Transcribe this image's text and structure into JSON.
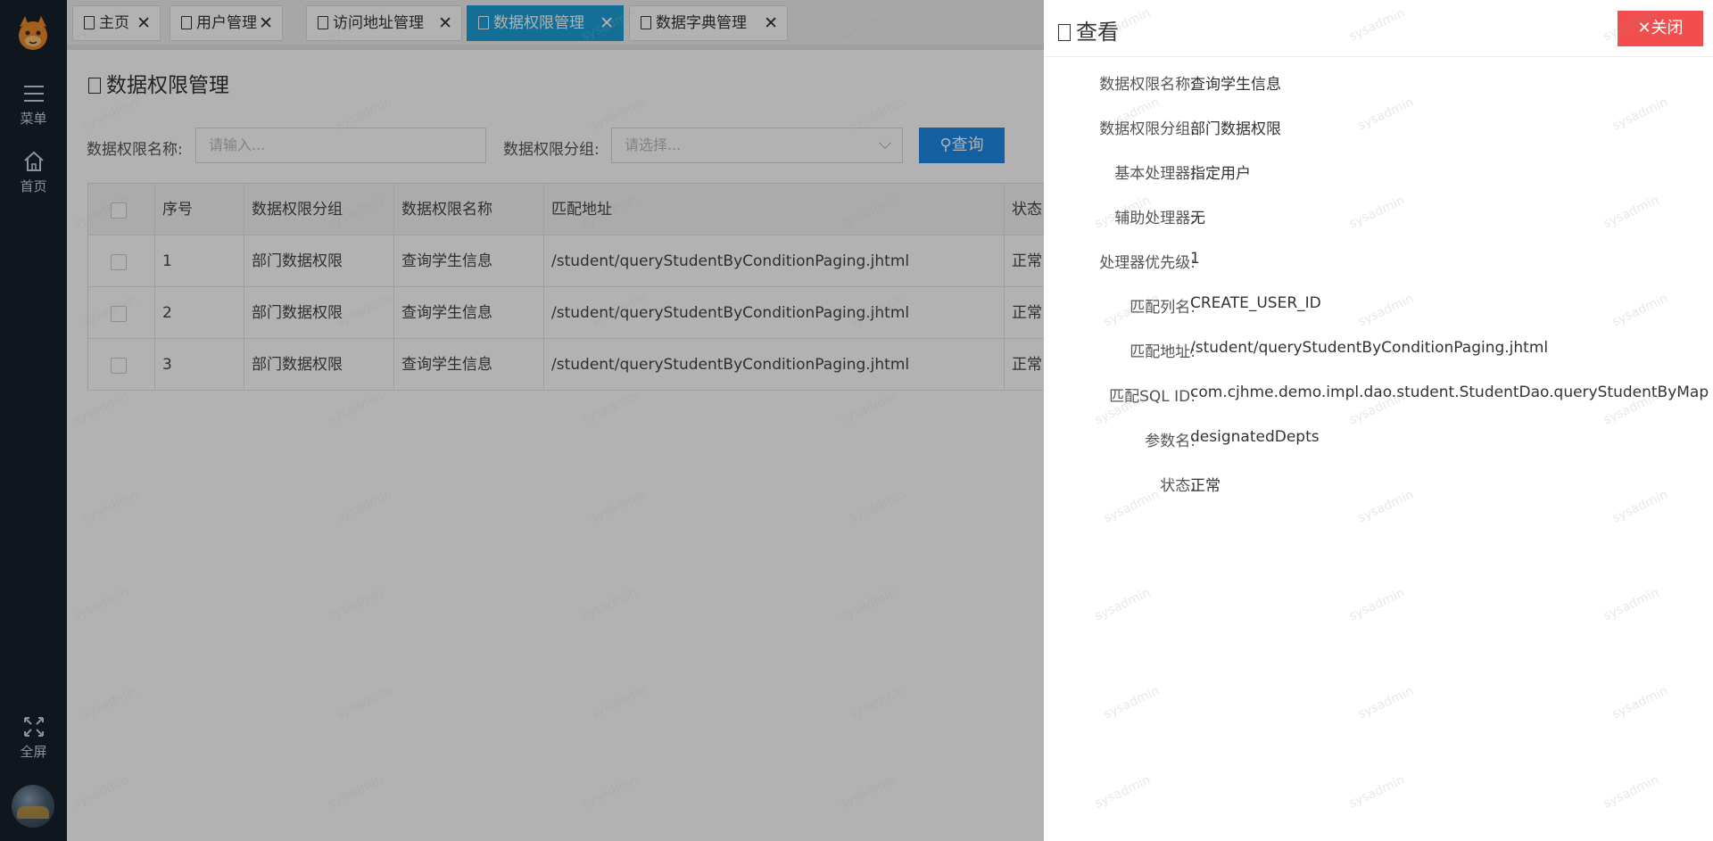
{
  "sidebar": {
    "menu_label": "菜单",
    "home_label": "首页",
    "fullscreen_label": "全屏"
  },
  "tabs": [
    {
      "label": "主页"
    },
    {
      "label": "用户管理"
    },
    {
      "label": "访问地址管理"
    },
    {
      "label": "数据权限管理"
    },
    {
      "label": "数据字典管理"
    }
  ],
  "page": {
    "title": "数据权限管理"
  },
  "filters": {
    "name_label": "数据权限名称:",
    "name_placeholder": "请输入...",
    "group_label": "数据权限分组:",
    "group_placeholder": "请选择...",
    "query_label": "查询"
  },
  "table": {
    "headers": [
      "序号",
      "数据权限分组",
      "数据权限名称",
      "匹配地址",
      "状态"
    ],
    "rows": [
      {
        "no": "1",
        "group": "部门数据权限",
        "name": "查询学生信息",
        "url": "/student/queryStudentByConditionPaging.jhtml",
        "status": "正常"
      },
      {
        "no": "2",
        "group": "部门数据权限",
        "name": "查询学生信息",
        "url": "/student/queryStudentByConditionPaging.jhtml",
        "status": "正常"
      },
      {
        "no": "3",
        "group": "部门数据权限",
        "name": "查询学生信息",
        "url": "/student/queryStudentByConditionPaging.jhtml",
        "status": "正常"
      }
    ]
  },
  "drawer": {
    "title": "查看",
    "close_label": "关闭",
    "fields": [
      {
        "label": "数据权限名称:",
        "value": "查询学生信息"
      },
      {
        "label": "数据权限分组:",
        "value": "部门数据权限"
      },
      {
        "label": "基本处理器:",
        "value": "指定用户"
      },
      {
        "label": "辅助处理器:",
        "value": "无"
      },
      {
        "label": "处理器优先级:",
        "value": "1"
      },
      {
        "label": "匹配列名:",
        "value": "CREATE_USER_ID"
      },
      {
        "label": "匹配地址:",
        "value": "/student/queryStudentByConditionPaging.jhtml"
      },
      {
        "label": "匹配SQL ID:",
        "value": "com.cjhme.demo.impl.dao.student.StudentDao.queryStudentByMap"
      },
      {
        "label": "参数名:",
        "value": "designatedDepts"
      },
      {
        "label": "状态:",
        "value": "正常"
      }
    ]
  },
  "watermark": "sysadmin",
  "colors": {
    "sidebar_bg": "#16202c",
    "active_tab": "#1e9fd8",
    "query_button": "#1e88e5",
    "close_button": "#f24e4e"
  }
}
